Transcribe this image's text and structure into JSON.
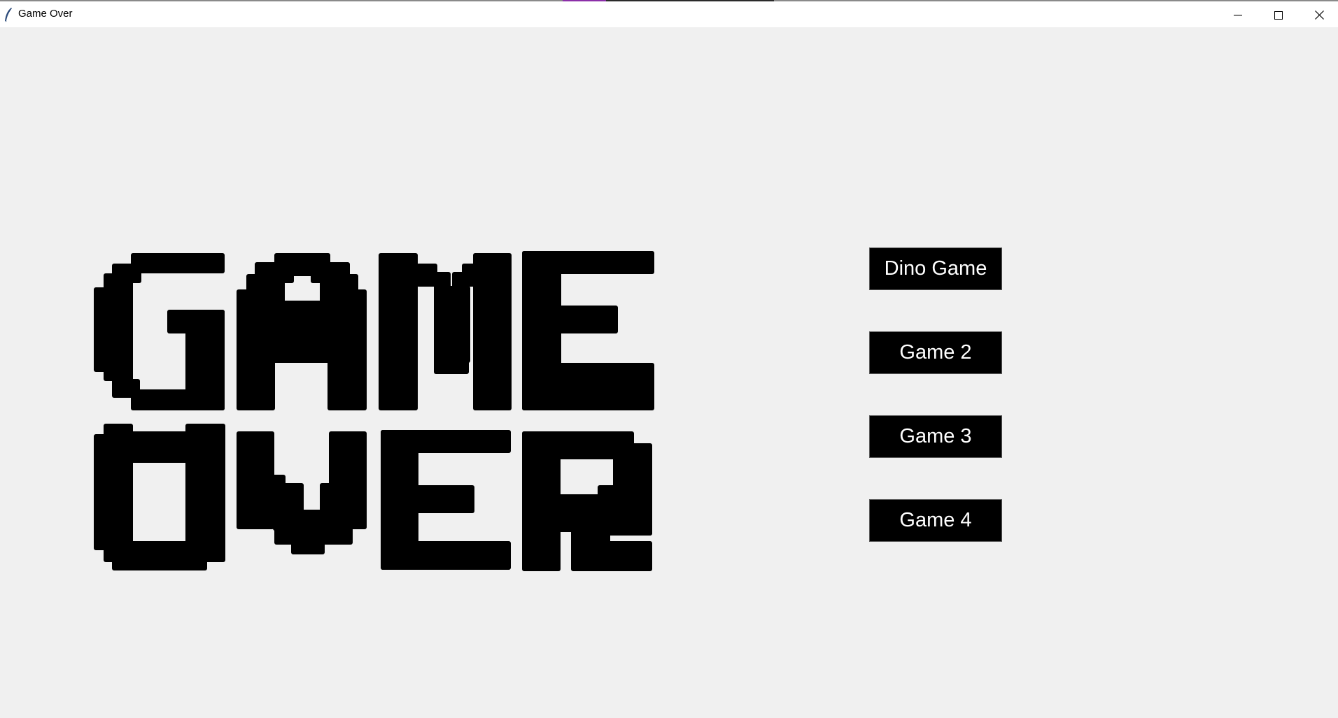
{
  "window": {
    "title": "Game Over",
    "controls": {
      "minimize_icon": "minimize-icon",
      "maximize_icon": "maximize-icon",
      "close_icon": "close-icon"
    }
  },
  "heading": {
    "line1": "GAME",
    "line2": "OVER"
  },
  "menu": {
    "buttons": [
      {
        "label": "Dino Game"
      },
      {
        "label": "Game 2"
      },
      {
        "label": "Game 3"
      },
      {
        "label": "Game 4"
      }
    ]
  },
  "colors": {
    "background": "#f0f0f0",
    "titlebar": "#ffffff",
    "button_bg": "#000000",
    "button_text": "#ffffff",
    "pixel_text": "#000000",
    "accent": "#8b2fa8"
  }
}
